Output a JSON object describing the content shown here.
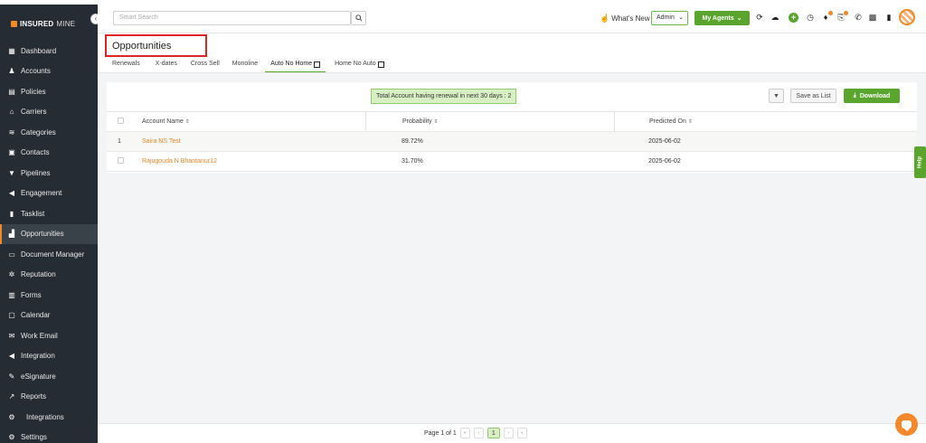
{
  "app": {
    "logo_bold": "INSURED",
    "logo_thin": "MINE"
  },
  "sidebar": {
    "items": [
      {
        "label": "Dashboard",
        "icon": "grid-icon"
      },
      {
        "label": "Accounts",
        "icon": "users-icon"
      },
      {
        "label": "Policies",
        "icon": "document-icon"
      },
      {
        "label": "Carriers",
        "icon": "bank-icon"
      },
      {
        "label": "Categories",
        "icon": "layers-icon"
      },
      {
        "label": "Contacts",
        "icon": "contact-card-icon"
      },
      {
        "label": "Pipelines",
        "icon": "funnel-icon"
      },
      {
        "label": "Engagement",
        "icon": "megaphone-icon"
      },
      {
        "label": "Tasklist",
        "icon": "clipboard-icon"
      },
      {
        "label": "Opportunities",
        "icon": "bar-chart-icon",
        "active": true
      },
      {
        "label": "Document Manager",
        "icon": "folder-icon"
      },
      {
        "label": "Reputation",
        "icon": "star-group-icon"
      },
      {
        "label": "Forms",
        "icon": "form-icon"
      },
      {
        "label": "Calendar",
        "icon": "calendar-icon"
      },
      {
        "label": "Work Email",
        "icon": "mail-icon"
      },
      {
        "label": "Integration",
        "icon": "plug-icon"
      },
      {
        "label": "eSignature",
        "icon": "signature-icon"
      },
      {
        "label": "Reports",
        "icon": "line-chart-icon"
      },
      {
        "label": "Integrations",
        "icon": "cogs-icon"
      },
      {
        "label": "Settings",
        "icon": "gear-icon"
      }
    ]
  },
  "topbar": {
    "search_placeholder": "Smart Search",
    "whats_new": "What's New",
    "role_select": "Admin",
    "agents_button": "My Agents"
  },
  "page": {
    "title": "Opportunities",
    "tabs": [
      {
        "label": "Renewals"
      },
      {
        "label": "X-dates"
      },
      {
        "label": "Cross Sell"
      },
      {
        "label": "Monoline"
      },
      {
        "label": "Auto No Home",
        "active": true
      },
      {
        "label": "Home No Auto"
      }
    ]
  },
  "toolbar": {
    "notice": "Total Account having renewal in next 30 days : 2",
    "save_as_list": "Save as List",
    "download": "Download"
  },
  "table": {
    "headers": [
      "Account Name",
      "Probability",
      "Predicted On"
    ],
    "rows": [
      {
        "index": "1",
        "account": "Saira NS Test",
        "probability": "89.72%",
        "predicted_on": "2025-06-02"
      },
      {
        "index": "",
        "account": "Rajugouda N Bhantanur12",
        "probability": "31.70%",
        "predicted_on": "2025-06-02"
      }
    ]
  },
  "pagination": {
    "summary": "Page 1 of 1",
    "current": "1"
  },
  "help": {
    "label": "Help"
  },
  "colors": {
    "accent": "#5aa52e",
    "brand": "#f08a24",
    "sidebar": "#252c33",
    "highlight_border": "#e02424"
  }
}
